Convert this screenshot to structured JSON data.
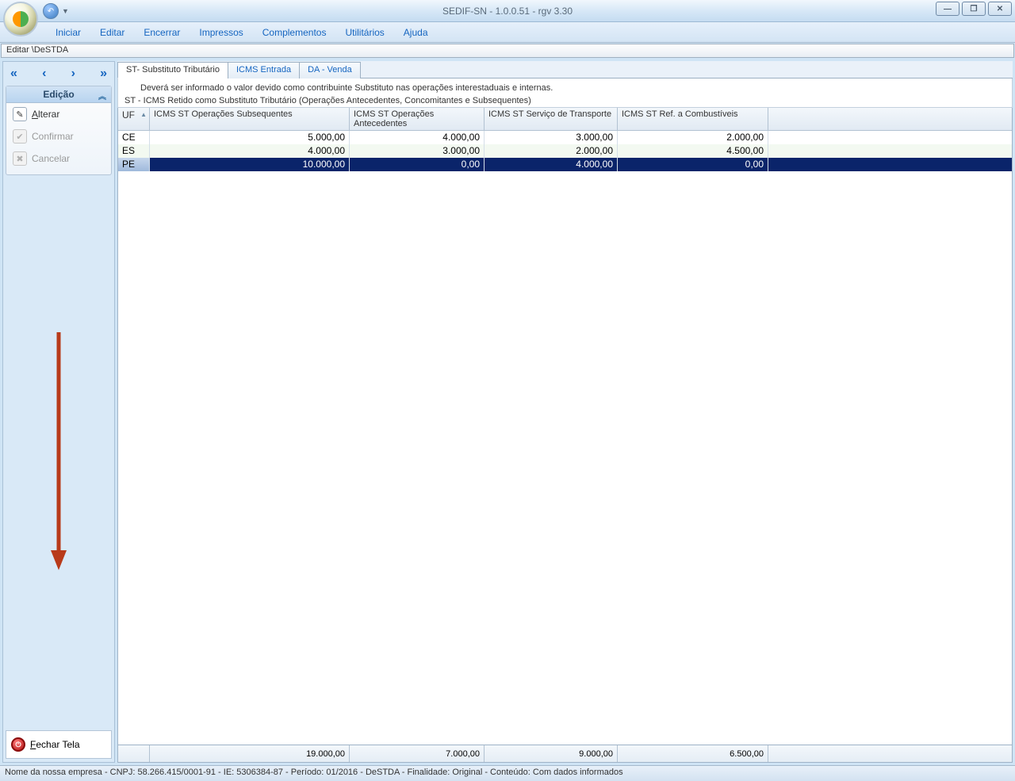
{
  "window": {
    "title": "SEDIF-SN - 1.0.0.51 - rgv 3.30"
  },
  "menu": {
    "iniciar": "Iniciar",
    "editar": "Editar",
    "encerrar": "Encerrar",
    "impressos": "Impressos",
    "complementos": "Complementos",
    "utilitarios": "Utilitários",
    "ajuda": "Ajuda"
  },
  "breadcrumb": "Editar \\DeSTDA",
  "sidebar": {
    "edicao_header": "Edição",
    "alterar": "Alterar",
    "confirmar": "Confirmar",
    "cancelar": "Cancelar",
    "fechar_tela": "Fechar Tela"
  },
  "tabs": {
    "st": "ST- Substituto Tributário",
    "icms_entrada": "ICMS Entrada",
    "da_venda": "DA - Venda"
  },
  "info": {
    "line1": "Deverá ser informado o valor devido como contribuinte Substituto nas operações interestaduais e internas.",
    "line2": "ST - ICMS Retido como Substituto Tributário (Operações Antecedentes, Concomitantes e Subsequentes)"
  },
  "grid": {
    "headers": {
      "uf": "UF",
      "c1": "ICMS ST Operações Subsequentes",
      "c2": "ICMS ST Operações Antecedentes",
      "c3": "ICMS ST Serviço de Transporte",
      "c4": "ICMS ST Ref. a Combustíveis"
    },
    "rows": [
      {
        "uf": "CE",
        "c1": "5.000,00",
        "c2": "4.000,00",
        "c3": "3.000,00",
        "c4": "2.000,00",
        "selected": false
      },
      {
        "uf": "ES",
        "c1": "4.000,00",
        "c2": "3.000,00",
        "c3": "2.000,00",
        "c4": "4.500,00",
        "selected": false
      },
      {
        "uf": "PE",
        "c1": "10.000,00",
        "c2": "0,00",
        "c3": "4.000,00",
        "c4": "0,00",
        "selected": true
      }
    ],
    "totals": {
      "c1": "19.000,00",
      "c2": "7.000,00",
      "c3": "9.000,00",
      "c4": "6.500,00"
    }
  },
  "statusbar": "Nome da nossa empresa - CNPJ: 58.266.415/0001-91 - IE: 5306384-87 - Período: 01/2016 - DeSTDA - Finalidade: Original - Conteúdo: Com dados informados"
}
